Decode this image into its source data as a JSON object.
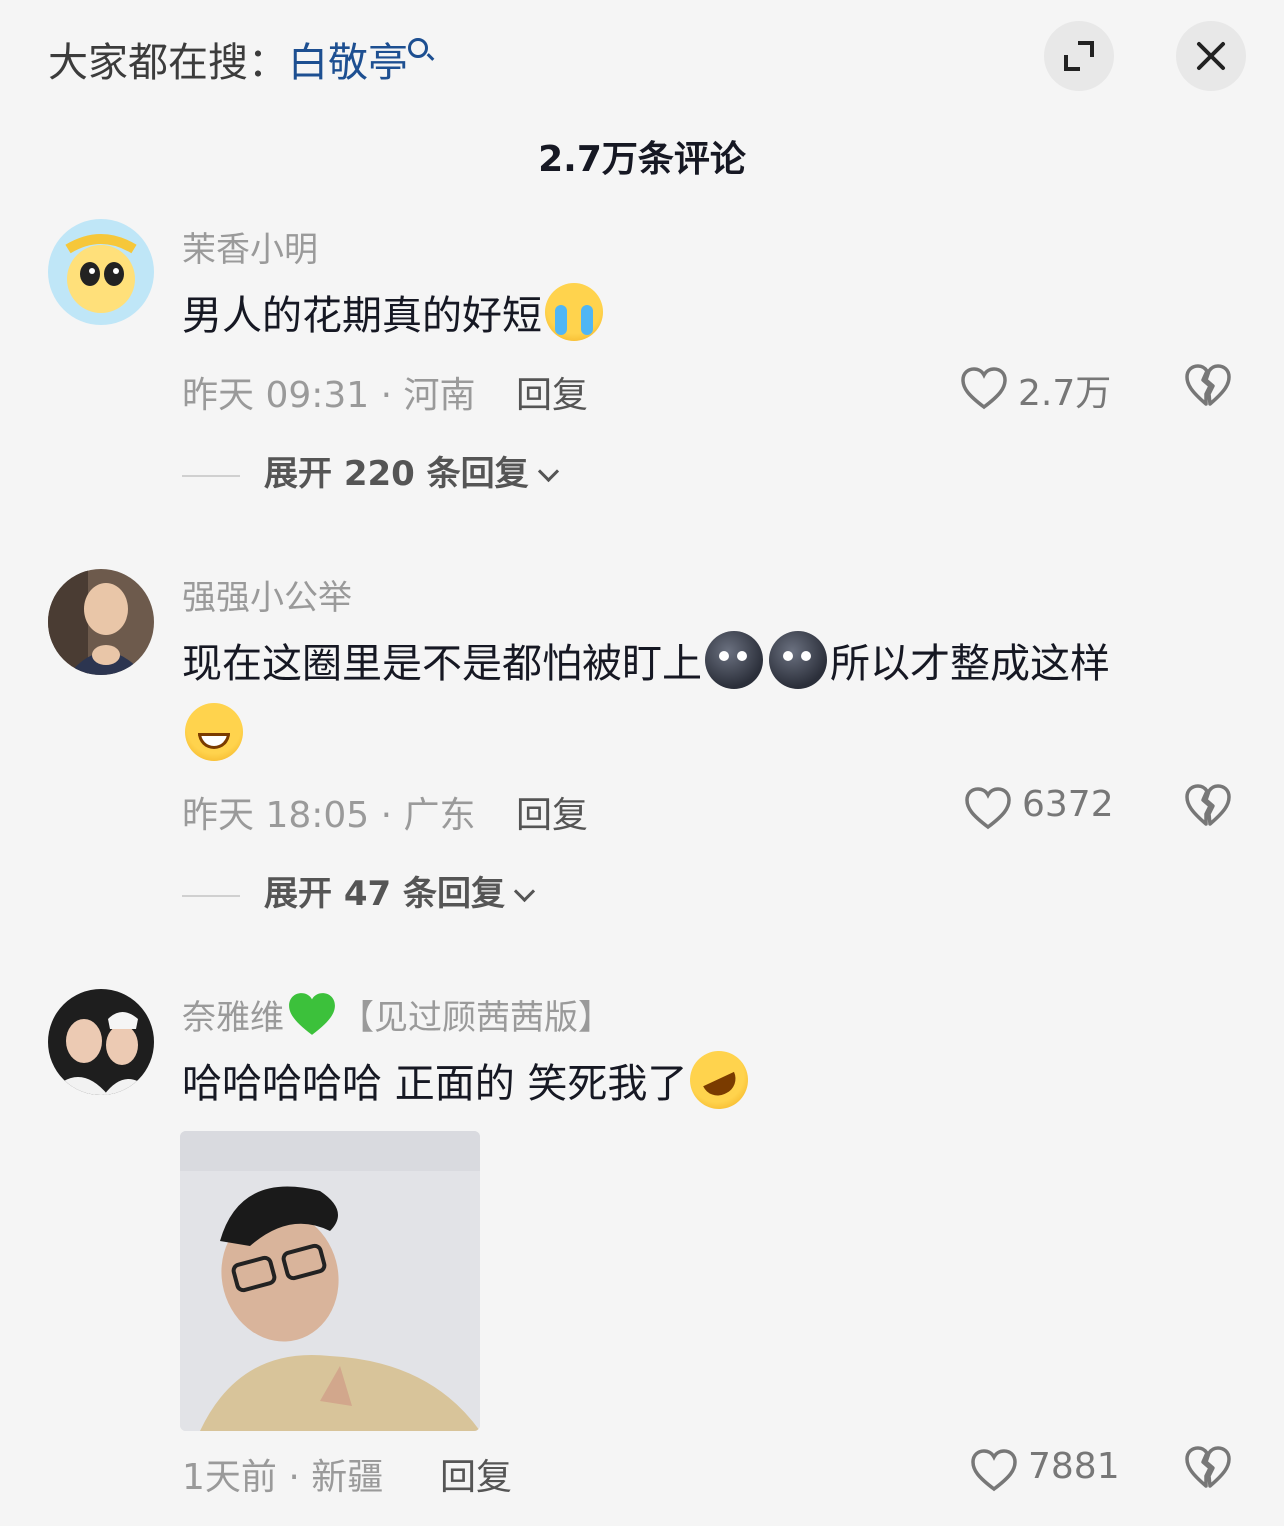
{
  "header": {
    "search_prefix": "大家都在搜：",
    "search_keyword": "白敬亭",
    "comment_count": "2.7万条评论"
  },
  "colors": {
    "keyword": "#1d4f91",
    "meta_gray": "#9a9a9a",
    "background": "#f5f5f5"
  },
  "comments": [
    {
      "username": "茉香小明",
      "text": "男人的花期真的好短",
      "emoji": "loudly-crying-face",
      "time_location": "昨天 09:31 · 河南",
      "reply_label": "回复",
      "likes": "2.7万",
      "expand_label": "展开 220 条回复"
    },
    {
      "username": "强强小公举",
      "text_a": "现在这圈里是不是都怕被盯上",
      "text_b": "所以才整成这样",
      "emojis": [
        "new-moon-face",
        "new-moon-face",
        "grinning-face"
      ],
      "time_location": "昨天 18:05 · 广东",
      "reply_label": "回复",
      "likes": "6372",
      "expand_label": "展开 47 条回复"
    },
    {
      "username": "奈雅维",
      "badge": "【见过顾茜茜版】",
      "text": "哈哈哈哈哈 正面的 笑死我了",
      "emoji": "rolling-on-floor-laughing",
      "time_location": "1天前 · 新疆",
      "reply_label": "回复",
      "likes": "7881"
    }
  ]
}
